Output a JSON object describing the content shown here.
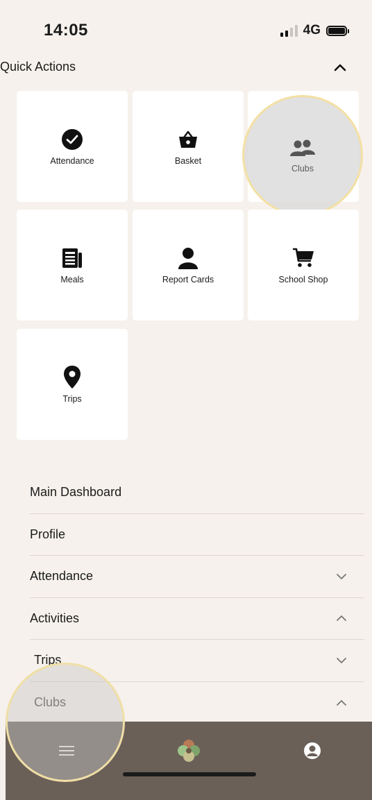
{
  "status_bar": {
    "time": "14:05",
    "network": "4G",
    "signal_icon": "signal-icon",
    "battery_icon": "battery-icon"
  },
  "quick_actions": {
    "title": "Quick Actions",
    "toggle_icon": "chevron-up-icon",
    "tiles": [
      {
        "label": "Attendance",
        "icon": "check-circle-icon"
      },
      {
        "label": "Basket",
        "icon": "basket-icon"
      },
      {
        "label": "Clubs",
        "icon": "users-icon"
      },
      {
        "label": "Meals",
        "icon": "newspaper-icon"
      },
      {
        "label": "Report Cards",
        "icon": "user-icon"
      },
      {
        "label": "School Shop",
        "icon": "cart-icon"
      },
      {
        "label": "Trips",
        "icon": "map-pin-icon"
      }
    ]
  },
  "menu": {
    "items": [
      {
        "label": "Main Dashboard",
        "chevron": ""
      },
      {
        "label": "Profile",
        "chevron": ""
      },
      {
        "label": "Attendance",
        "chevron": "chevron-down-icon"
      },
      {
        "label": "Activities",
        "chevron": "chevron-up-icon"
      },
      {
        "label": "Trips",
        "chevron": "chevron-down-icon"
      },
      {
        "label": "Clubs",
        "chevron": "chevron-up-icon"
      }
    ]
  },
  "bottom_nav": {
    "items": [
      {
        "icon": "hamburger-menu-icon"
      },
      {
        "icon": "app-logo-icon"
      },
      {
        "icon": "account-icon"
      }
    ]
  },
  "colors": {
    "background": "#f6f1ec",
    "tile_bg": "#ffffff",
    "bottom_bar": "#6b6058",
    "highlight_ring": "#f3e0a4"
  }
}
